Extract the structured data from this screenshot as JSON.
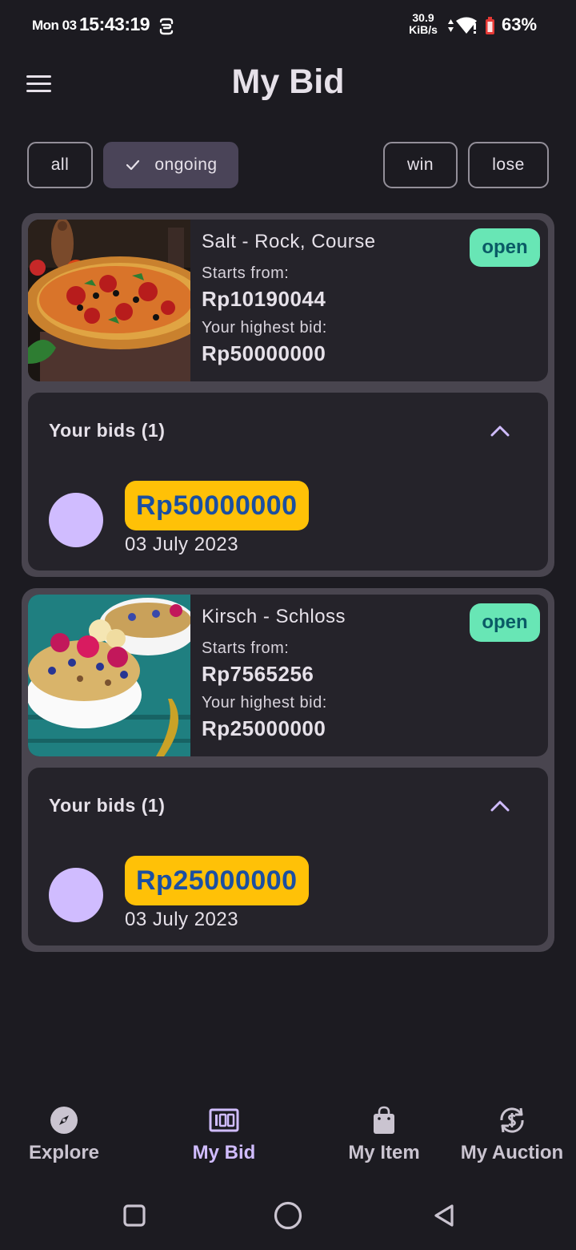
{
  "status_bar": {
    "day": "Mon 03",
    "time": "15:43:19",
    "speed_value": "30.9",
    "speed_unit": "KiB/s",
    "battery": "63%",
    "icons": [
      "sync-icon",
      "data-arrows-icon",
      "wifi-alert-icon",
      "battery-saver-icon"
    ]
  },
  "header": {
    "title": "My Bid",
    "menu_icon": "hamburger-menu-icon"
  },
  "filters": [
    {
      "label": "all",
      "selected": false
    },
    {
      "label": "ongoing",
      "selected": true
    },
    {
      "label": "win",
      "selected": false
    },
    {
      "label": "lose",
      "selected": false
    }
  ],
  "bids": [
    {
      "item_name": "Salt - Rock, Course",
      "status": "open",
      "starts_label": "Starts from:",
      "starts_value": "Rp10190044",
      "highest_label": "Your highest bid:",
      "highest_value": "Rp50000000",
      "image": "pizza-photo",
      "your_bids_label": "Your bids (1)",
      "entries": [
        {
          "amount": "Rp50000000",
          "date": "03 July 2023"
        }
      ]
    },
    {
      "item_name": "Kirsch - Schloss",
      "status": "open",
      "starts_label": "Starts from:",
      "starts_value": "Rp7565256",
      "highest_label": "Your highest bid:",
      "highest_value": "Rp25000000",
      "image": "granola-bowl-photo",
      "your_bids_label": "Your bids (1)",
      "entries": [
        {
          "amount": "Rp25000000",
          "date": "03 July 2023"
        }
      ]
    }
  ],
  "bottom_nav": [
    {
      "label": "Explore",
      "icon": "compass-icon",
      "active": false
    },
    {
      "label": "My Bid",
      "icon": "bid-100-icon",
      "active": true
    },
    {
      "label": "My Item",
      "icon": "shopping-bag-icon",
      "active": false
    },
    {
      "label": "My Auction",
      "icon": "currency-exchange-icon",
      "active": false
    }
  ],
  "colors": {
    "background": "#1c1b21",
    "card_border": "#49454f",
    "panel": "#25232a",
    "open_badge": "#68e6b5",
    "open_text": "#0a5b66",
    "bid_amount_bg": "#ffc107",
    "bid_amount_text": "#1b4fa1",
    "accent": "#d0bcff",
    "chip_selected": "#4a4458"
  }
}
